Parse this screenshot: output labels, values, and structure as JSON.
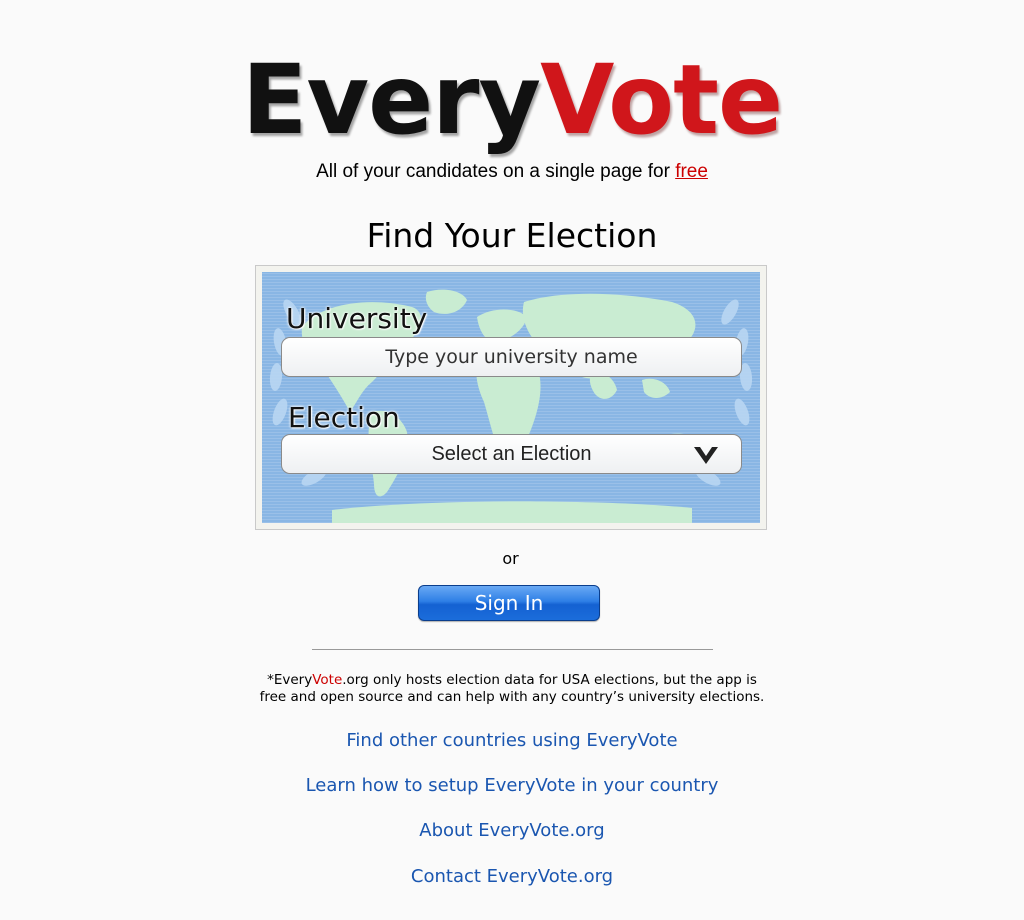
{
  "logo": {
    "part1": "Every",
    "part2": "Vote"
  },
  "tagline": {
    "text": "All of your candidates on a single page for ",
    "link": "free"
  },
  "find_title": "Find Your Election",
  "form": {
    "university_label": "University",
    "university_placeholder": "Type your university name",
    "election_label": "Election",
    "election_selected": "Select an Election"
  },
  "or_text": "or",
  "signin_label": "Sign In",
  "note": {
    "prefix": "*Every",
    "vote": "Vote",
    "line1_rest": ".org only hosts election data for USA elections, but the app is",
    "line2": "free and open source and can help with any country’s university elections."
  },
  "links": {
    "other_countries": "Find other countries using EveryVote",
    "setup": "Learn how to setup EveryVote in your country",
    "about": "About EveryVote.org",
    "contact": "Contact EveryVote.org"
  },
  "colors": {
    "brand_red": "#d0161b",
    "link_blue": "#1a56b0",
    "map_blue": "#89b6e4",
    "button_blue": "#2e7fe6"
  },
  "icons": {
    "dropdown": "chevron-down-icon",
    "map": "world-map-laurel"
  }
}
